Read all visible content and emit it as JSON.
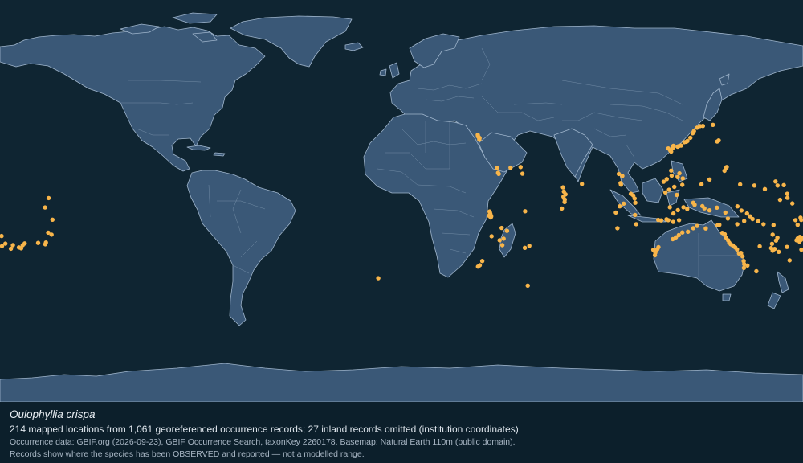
{
  "caption": {
    "species": "Oulophyllia crispa",
    "summary": "214 mapped locations from 1,061 georeferenced occurrence records; 27 inland records omitted (institution coordinates)",
    "source": "Occurrence data: GBIF.org (2026-09-23), GBIF Occurrence Search, taxonKey 2260178. Basemap: Natural Earth 110m (public domain).",
    "note": "Records show where the species has been OBSERVED and reported — not a modelled range."
  },
  "map": {
    "projection": "equirectangular",
    "background_color": "#0f2532",
    "land_color": "#3a5877",
    "coastline_color": "#9fb5cc",
    "marker_color": "#f8b54a",
    "lon_range": [
      -180,
      180
    ],
    "lat_range": [
      -90,
      90
    ]
  },
  "occurrences": [
    [
      -158.2,
      1.3
    ],
    [
      -159.8,
      -2.9
    ],
    [
      -156.5,
      -8.4
    ],
    [
      -158.4,
      -14.2
    ],
    [
      -159.4,
      -18.6
    ],
    [
      -159.7,
      -19.4
    ],
    [
      -156.9,
      -15.1
    ],
    [
      -169.8,
      -19.8
    ],
    [
      -170.5,
      -21.2
    ],
    [
      -171.5,
      -20.8
    ],
    [
      -168.9,
      -19.0
    ],
    [
      -162.9,
      -18.8
    ],
    [
      34.9,
      27.9
    ],
    [
      34.6,
      28.6
    ],
    [
      34.2,
      29.6
    ],
    [
      34.9,
      27.4
    ],
    [
      35.0,
      28.2
    ],
    [
      34.3,
      28.9
    ],
    [
      42.8,
      14.8
    ],
    [
      43.3,
      12.6
    ],
    [
      48.9,
      14.9
    ],
    [
      54.2,
      12.2
    ],
    [
      53.4,
      15.2
    ],
    [
      43.6,
      12.1
    ],
    [
      39.5,
      -4.7
    ],
    [
      39.7,
      -5.5
    ],
    [
      40.2,
      -6.9
    ],
    [
      39.9,
      -6.0
    ],
    [
      39.6,
      -5.0
    ],
    [
      39.2,
      -6.6
    ],
    [
      40.0,
      -7.4
    ],
    [
      44.9,
      -12.1
    ],
    [
      47.3,
      -13.4
    ],
    [
      44.0,
      -17.6
    ],
    [
      40.4,
      -15.8
    ],
    [
      45.2,
      -19.8
    ],
    [
      45.8,
      -16.9
    ],
    [
      55.4,
      -4.6
    ],
    [
      57.3,
      -20.1
    ],
    [
      55.3,
      -21.0
    ],
    [
      34.3,
      -29.4
    ],
    [
      35.1,
      -28.8
    ],
    [
      36.2,
      -26.9
    ],
    [
      72.8,
      4.2
    ],
    [
      73.5,
      3.0
    ],
    [
      72.6,
      1.9
    ],
    [
      73.1,
      -0.5
    ],
    [
      73.2,
      0.6
    ],
    [
      71.9,
      -3.4
    ],
    [
      72.4,
      6.1
    ],
    [
      80.9,
      7.6
    ],
    [
      98.2,
      8.0
    ],
    [
      98.4,
      7.3
    ],
    [
      97.4,
      12.1
    ],
    [
      99.0,
      11.2
    ],
    [
      102.8,
      3.2
    ],
    [
      103.9,
      2.5
    ],
    [
      104.5,
      1.1
    ],
    [
      104.8,
      -0.8
    ],
    [
      99.6,
      -1.2
    ],
    [
      97.8,
      -2.4
    ],
    [
      96.1,
      -5.2
    ],
    [
      104.7,
      -6.3
    ],
    [
      105.2,
      -10.4
    ],
    [
      96.8,
      -12.2
    ],
    [
      117.5,
      8.6
    ],
    [
      118.9,
      9.8
    ],
    [
      120.9,
      13.6
    ],
    [
      121.1,
      11.3
    ],
    [
      123.8,
      10.7
    ],
    [
      124.6,
      12.4
    ],
    [
      119.9,
      5.0
    ],
    [
      118.3,
      3.8
    ],
    [
      122.3,
      6.3
    ],
    [
      125.9,
      7.2
    ],
    [
      126.1,
      10.1
    ],
    [
      123.4,
      2.7
    ],
    [
      120.3,
      -2.8
    ],
    [
      121.9,
      -5.6
    ],
    [
      123.9,
      -4.1
    ],
    [
      118.8,
      -8.2
    ],
    [
      116.4,
      -8.7
    ],
    [
      115.1,
      -8.5
    ],
    [
      119.6,
      -8.6
    ],
    [
      121.8,
      -9.4
    ],
    [
      124.4,
      -8.6
    ],
    [
      126.4,
      -2.8
    ],
    [
      128.1,
      -3.6
    ],
    [
      130.8,
      -0.8
    ],
    [
      131.4,
      -1.7
    ],
    [
      134.9,
      -2.3
    ],
    [
      135.8,
      -3.3
    ],
    [
      138.1,
      -4.2
    ],
    [
      141.4,
      -3.0
    ],
    [
      145.2,
      -5.2
    ],
    [
      146.3,
      -7.9
    ],
    [
      150.6,
      -2.4
    ],
    [
      152.4,
      -4.3
    ],
    [
      150.5,
      -10.4
    ],
    [
      153.6,
      -9.0
    ],
    [
      154.9,
      -5.6
    ],
    [
      156.3,
      -6.9
    ],
    [
      157.4,
      -8.1
    ],
    [
      159.9,
      -9.1
    ],
    [
      162.3,
      -10.4
    ],
    [
      166.8,
      -10.8
    ],
    [
      166.4,
      -15.1
    ],
    [
      167.9,
      -17.7
    ],
    [
      168.5,
      -16.4
    ],
    [
      165.7,
      -21.1
    ],
    [
      166.4,
      -22.3
    ],
    [
      177.1,
      -17.6
    ],
    [
      178.4,
      -18.2
    ],
    [
      179.7,
      -16.4
    ],
    [
      177.6,
      -16.8
    ],
    [
      179.1,
      -17.4
    ],
    [
      178.6,
      -16.1
    ],
    [
      112.9,
      -21.9
    ],
    [
      113.6,
      -24.3
    ],
    [
      114.0,
      -22.2
    ],
    [
      113.8,
      -23.1
    ],
    [
      115.2,
      -20.7
    ],
    [
      114.7,
      -21.6
    ],
    [
      121.6,
      -17.1
    ],
    [
      123.0,
      -16.3
    ],
    [
      124.3,
      -15.3
    ],
    [
      125.9,
      -14.1
    ],
    [
      128.4,
      -13.8
    ],
    [
      130.8,
      -12.2
    ],
    [
      132.5,
      -11.2
    ],
    [
      136.4,
      -12.3
    ],
    [
      141.7,
      -10.9
    ],
    [
      142.5,
      -10.7
    ],
    [
      143.8,
      -14.3
    ],
    [
      144.9,
      -14.9
    ],
    [
      145.5,
      -16.4
    ],
    [
      146.4,
      -17.6
    ],
    [
      146.9,
      -18.7
    ],
    [
      147.6,
      -19.4
    ],
    [
      148.5,
      -19.9
    ],
    [
      149.6,
      -20.8
    ],
    [
      150.4,
      -21.7
    ],
    [
      151.3,
      -23.5
    ],
    [
      152.2,
      -23.3
    ],
    [
      152.9,
      -24.8
    ],
    [
      153.4,
      -26.9
    ],
    [
      153.6,
      -28.3
    ],
    [
      153.5,
      -30.0
    ],
    [
      155.1,
      -28.9
    ],
    [
      159.1,
      -31.5
    ],
    [
      160.6,
      -20.3
    ],
    [
      166.1,
      -19.2
    ],
    [
      167.3,
      -21.5
    ],
    [
      169.1,
      -22.8
    ],
    [
      172.8,
      -20.6
    ],
    [
      174.0,
      -26.6
    ],
    [
      180.0,
      -21.8
    ],
    [
      -177.6,
      -19.1
    ],
    [
      -179.1,
      -20.2
    ],
    [
      -179.6,
      -15.7
    ],
    [
      -175.1,
      -21.4
    ],
    [
      -174.2,
      -19.8
    ],
    [
      120.9,
      22.1
    ],
    [
      121.5,
      23.6
    ],
    [
      121.9,
      24.7
    ],
    [
      119.6,
      23.5
    ],
    [
      120.5,
      22.6
    ],
    [
      123.8,
      24.3
    ],
    [
      124.2,
      24.5
    ],
    [
      125.3,
      24.8
    ],
    [
      126.8,
      26.3
    ],
    [
      127.7,
      26.5
    ],
    [
      128.2,
      26.9
    ],
    [
      129.5,
      28.3
    ],
    [
      130.5,
      30.3
    ],
    [
      131.1,
      31.3
    ],
    [
      132.5,
      32.8
    ],
    [
      133.8,
      33.5
    ],
    [
      135.1,
      33.6
    ],
    [
      139.6,
      34.1
    ],
    [
      141.5,
      26.6
    ],
    [
      142.2,
      27.1
    ],
    [
      145.6,
      14.9
    ],
    [
      144.8,
      13.5
    ],
    [
      145.8,
      15.2
    ],
    [
      134.5,
      7.5
    ],
    [
      138.1,
      9.6
    ],
    [
      151.8,
      7.4
    ],
    [
      158.2,
      6.9
    ],
    [
      162.9,
      5.3
    ],
    [
      167.7,
      8.7
    ],
    [
      171.4,
      7.1
    ],
    [
      168.6,
      6.9
    ],
    [
      172.9,
      3.2
    ],
    [
      169.7,
      0.5
    ],
    [
      175.2,
      -1.1
    ],
    [
      173.0,
      1.4
    ],
    [
      176.6,
      -8.6
    ],
    [
      179.2,
      -8.5
    ],
    [
      178.9,
      -7.5
    ],
    [
      177.6,
      -10.7
    ],
    [
      56.6,
      -37.9
    ],
    [
      -10.4,
      -34.6
    ]
  ]
}
